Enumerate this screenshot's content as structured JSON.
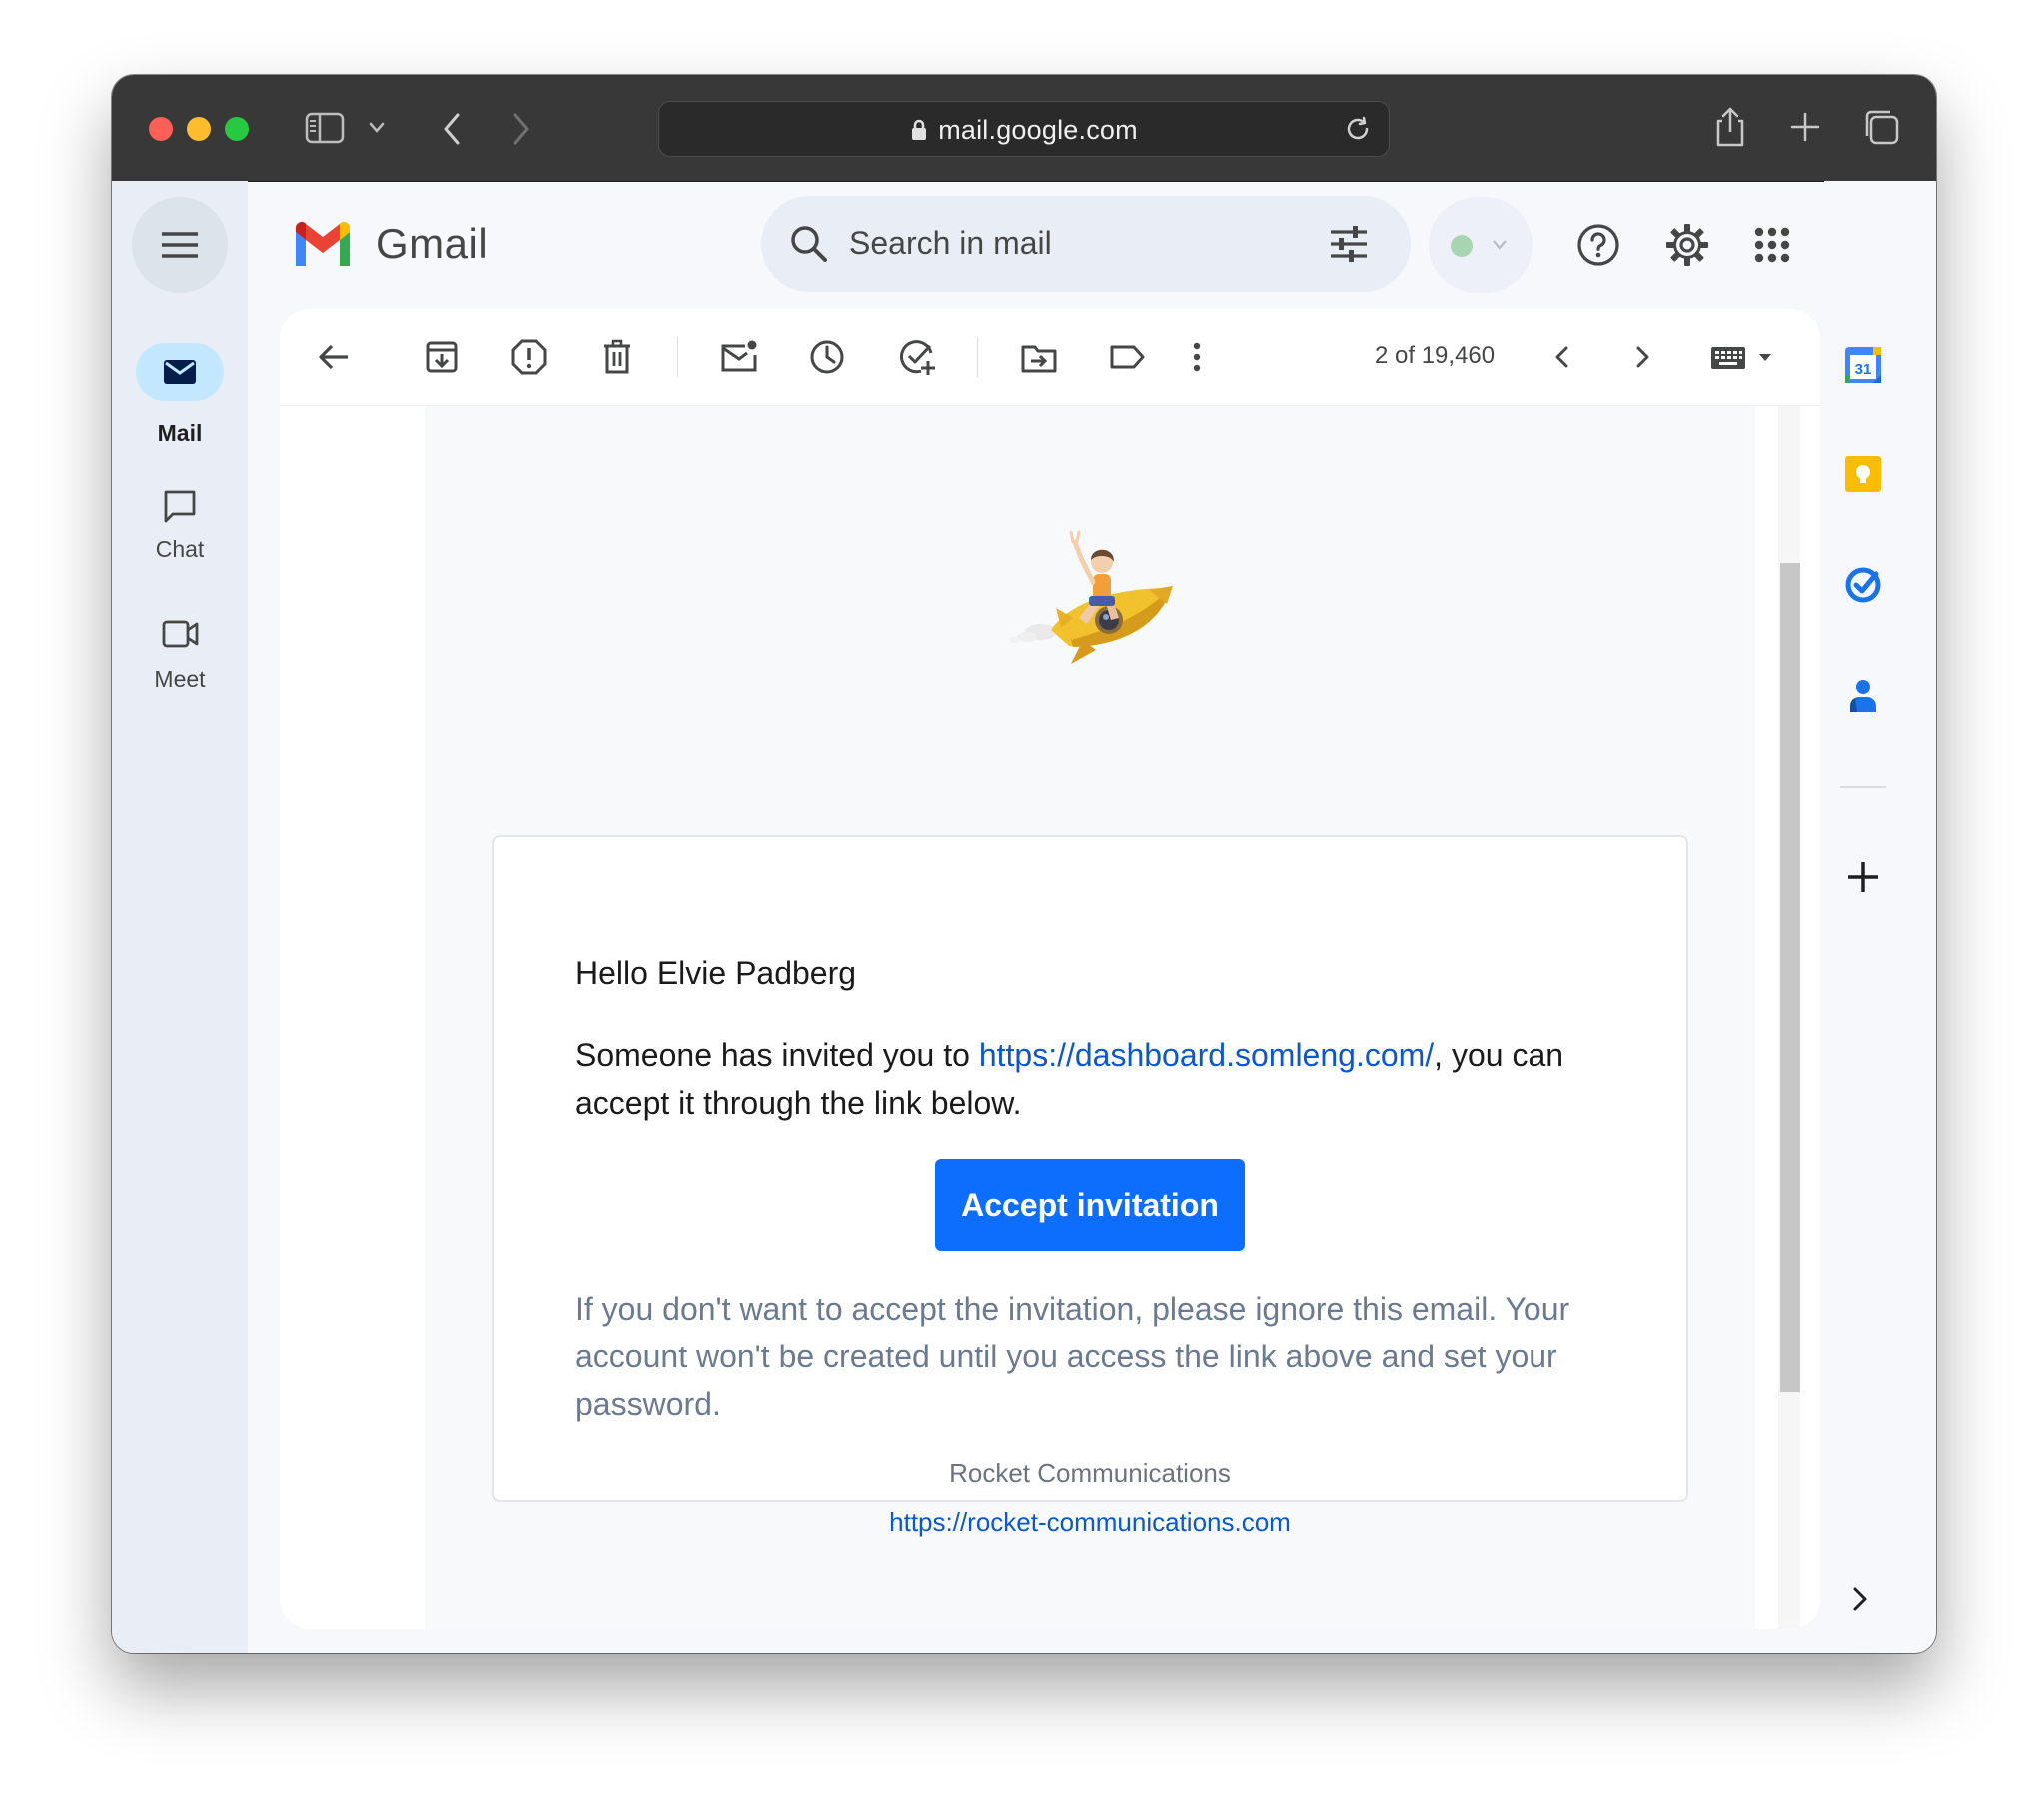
{
  "browser": {
    "url": "mail.google.com"
  },
  "app": {
    "name": "Gmail"
  },
  "nav": {
    "items": [
      {
        "label": "Mail",
        "icon": "mail-icon",
        "active": true
      },
      {
        "label": "Chat",
        "icon": "chat-icon",
        "active": false
      },
      {
        "label": "Meet",
        "icon": "video-icon",
        "active": false
      }
    ]
  },
  "search": {
    "placeholder": "Search in mail"
  },
  "toolbar": {
    "count": "2 of 19,460"
  },
  "email": {
    "greeting": "Hello Elvie Padberg",
    "invite_prefix": "Someone has invited you to ",
    "invite_link": "https://dashboard.somleng.com/",
    "invite_suffix": ", you can accept it through the link below.",
    "button_label": "Accept invitation",
    "ignore_text": "If you don't want to accept the invitation, please ignore this email. Your account won't be created until you access the link above and set your password.",
    "footer_name": "Rocket Communications",
    "footer_link": "https://rocket-communications.com"
  },
  "colors": {
    "primary_button": "#0d6efd",
    "link": "#0b57d0",
    "rail_active": "#c2e7ff"
  }
}
